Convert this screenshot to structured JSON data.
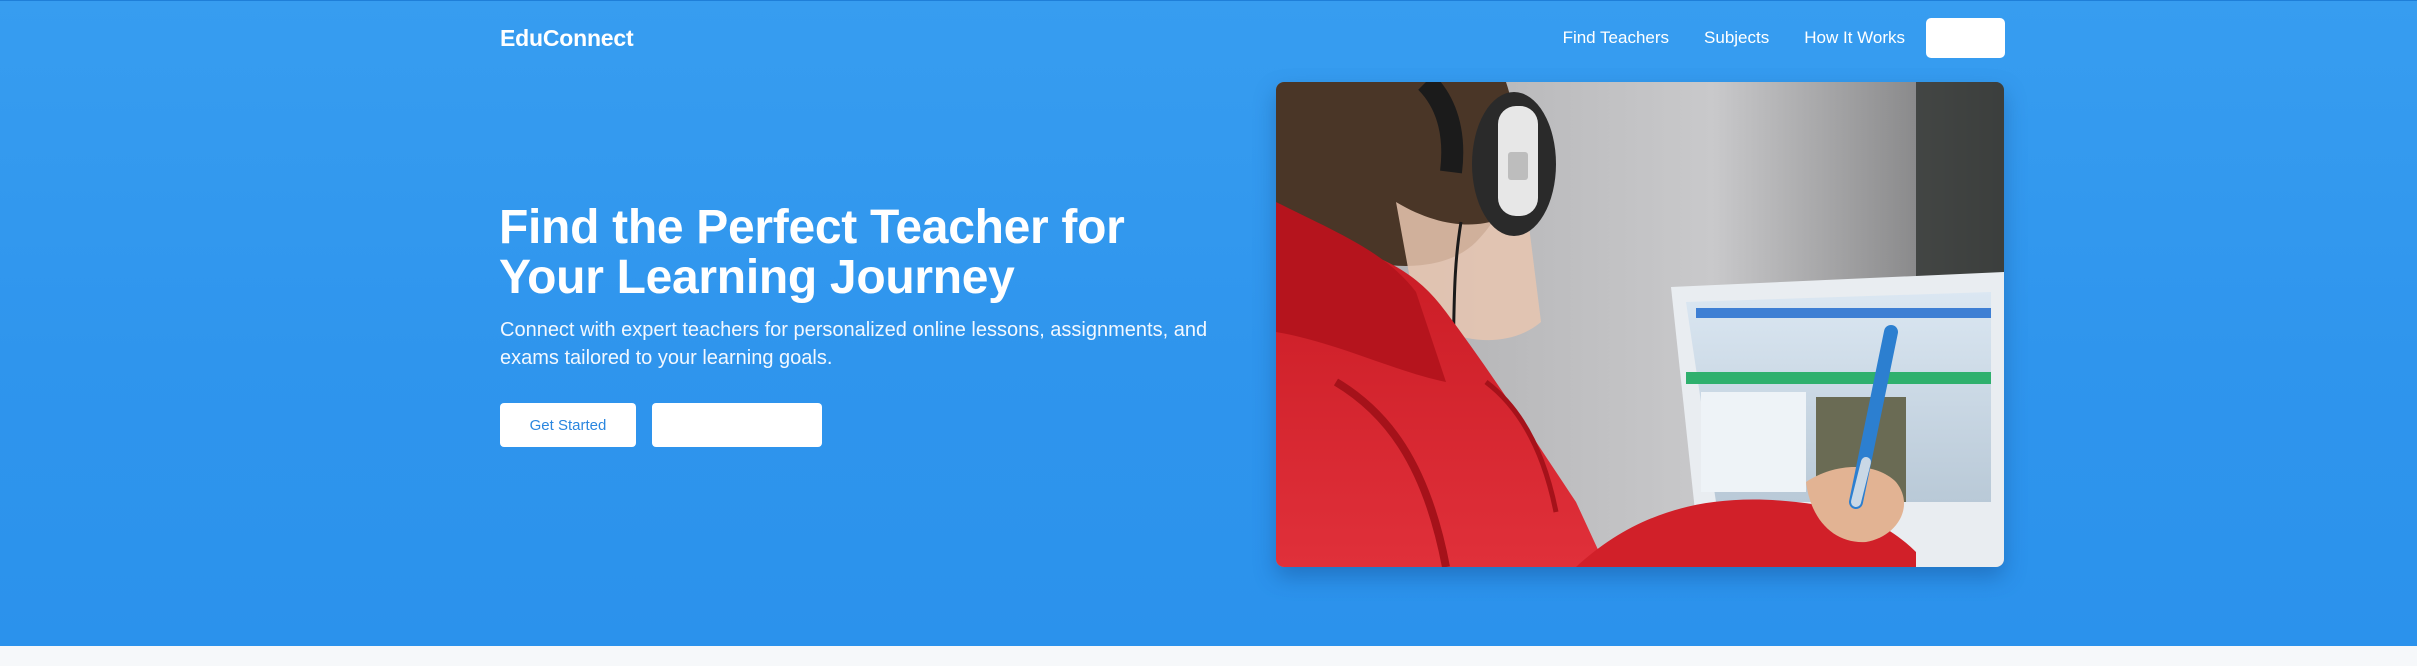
{
  "brand": {
    "name": "EduConnect"
  },
  "nav": {
    "links": [
      "Find Teachers",
      "Subjects",
      "How It Works"
    ],
    "cta_label": ""
  },
  "hero": {
    "headline_line1": "Find the Perfect Teacher for",
    "headline_line2": "Your Learning Journey",
    "subline": "Connect with expert teachers for personalized online lessons, assignments, and exams tailored to your learning goals.",
    "primary_button": "Get Started",
    "secondary_button": ""
  },
  "colors": {
    "hero_background": "#2f95ed",
    "button_background": "#ffffff",
    "button_text": "#2a86df"
  }
}
